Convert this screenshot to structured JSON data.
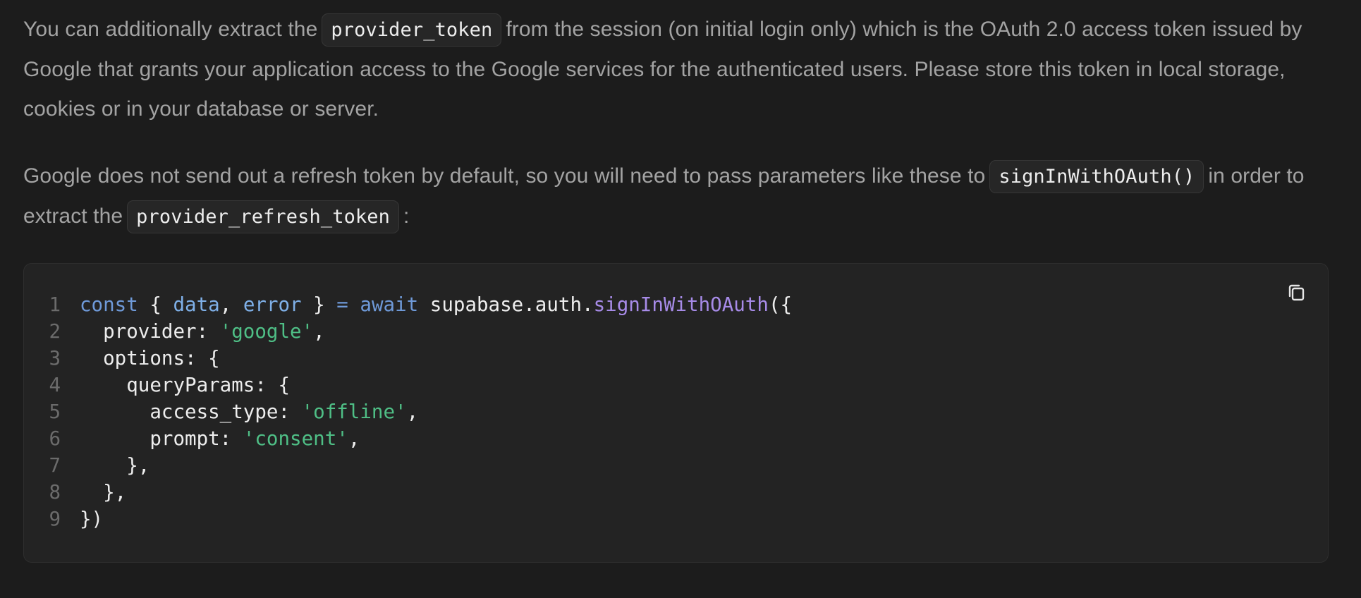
{
  "paragraph1": {
    "pre": "You can additionally extract the",
    "code": "provider_token",
    "post": "from the session (on initial login only) which is the OAuth 2.0 access token issued by Google that grants your application access to the Google services for the authenticated users. Please store this token in local storage, cookies or in your database or server."
  },
  "paragraph2": {
    "pre": "Google does not send out a refresh token by default, so you will need to pass parameters like these to",
    "code1": "signInWithOAuth()",
    "mid": "in order to extract the",
    "code2": "provider_refresh_token",
    "post": ":"
  },
  "code_block": {
    "language": "javascript",
    "copy_icon": "copy-icon",
    "lines": [
      {
        "number": "1",
        "tokens": [
          {
            "t": "kw",
            "v": "const"
          },
          {
            "t": "plain",
            "v": " { "
          },
          {
            "t": "var",
            "v": "data"
          },
          {
            "t": "plain",
            "v": ", "
          },
          {
            "t": "var",
            "v": "error"
          },
          {
            "t": "plain",
            "v": " } "
          },
          {
            "t": "kw",
            "v": "="
          },
          {
            "t": "plain",
            "v": " "
          },
          {
            "t": "kw",
            "v": "await"
          },
          {
            "t": "plain",
            "v": " supabase.auth."
          },
          {
            "t": "fn",
            "v": "signInWithOAuth"
          },
          {
            "t": "plain",
            "v": "({"
          }
        ]
      },
      {
        "number": "2",
        "tokens": [
          {
            "t": "plain",
            "v": "  provider: "
          },
          {
            "t": "str",
            "v": "'google'"
          },
          {
            "t": "plain",
            "v": ","
          }
        ]
      },
      {
        "number": "3",
        "tokens": [
          {
            "t": "plain",
            "v": "  options: {"
          }
        ]
      },
      {
        "number": "4",
        "tokens": [
          {
            "t": "plain",
            "v": "    queryParams: {"
          }
        ]
      },
      {
        "number": "5",
        "tokens": [
          {
            "t": "plain",
            "v": "      access_type: "
          },
          {
            "t": "str",
            "v": "'offline'"
          },
          {
            "t": "plain",
            "v": ","
          }
        ]
      },
      {
        "number": "6",
        "tokens": [
          {
            "t": "plain",
            "v": "      prompt: "
          },
          {
            "t": "str",
            "v": "'consent'"
          },
          {
            "t": "plain",
            "v": ","
          }
        ]
      },
      {
        "number": "7",
        "tokens": [
          {
            "t": "plain",
            "v": "    },"
          }
        ]
      },
      {
        "number": "8",
        "tokens": [
          {
            "t": "plain",
            "v": "  },"
          }
        ]
      },
      {
        "number": "9",
        "tokens": [
          {
            "t": "plain",
            "v": "})"
          }
        ]
      }
    ]
  },
  "colors": {
    "background": "#1c1c1c",
    "code_background": "#232323",
    "body_text": "#a3a3a3",
    "keyword": "#6f9ad9",
    "variable": "#7fb0e8",
    "string": "#4fbf86",
    "function": "#a78be8",
    "line_number": "#6b6b6b"
  }
}
